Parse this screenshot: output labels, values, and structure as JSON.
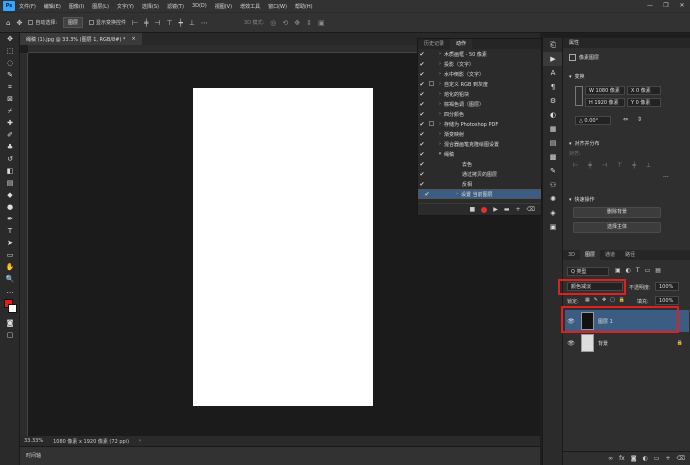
{
  "app": {
    "logo": "Ps"
  },
  "menu": [
    "文件(F)",
    "编辑(E)",
    "图像(I)",
    "图层(L)",
    "文字(Y)",
    "选择(S)",
    "滤镜(T)",
    "3D(D)",
    "视图(V)",
    "增效工具",
    "窗口(W)",
    "帮助(H)"
  ],
  "options": {
    "auto_select": "自动选择:",
    "target": "图层",
    "transform": "显示变换控件",
    "mode3d": "3D 模式:"
  },
  "document": {
    "tab": "绳稿 (1).jpg @ 33.3% (图层 1, RGB/8#) *",
    "close": "×"
  },
  "status": {
    "zoom": "33.33%",
    "size": "1080 像素 x 1920 像素 (72 ppi)"
  },
  "timeline": {
    "label": "时间轴"
  },
  "actions_panel": {
    "tabs": [
      "历史记录",
      "动作"
    ],
    "rows": [
      {
        "label": "木质画框 - 50 像素",
        "check": true,
        "box": false,
        "expand": true
      },
      {
        "label": "投影（文字）",
        "check": true,
        "box": false,
        "expand": true
      },
      {
        "label": "水中倒影（文字）",
        "check": true,
        "box": false,
        "expand": true
      },
      {
        "label": "自定义 RGB 到灰度",
        "check": true,
        "box": true,
        "expand": true
      },
      {
        "label": "熔化的铅块",
        "check": true,
        "box": false,
        "expand": true
      },
      {
        "label": "棕褐色调（图层）",
        "check": true,
        "box": false,
        "expand": true
      },
      {
        "label": "四分颜色",
        "check": true,
        "box": false,
        "expand": true
      },
      {
        "label": "存储为 Photoshop PDF",
        "check": true,
        "box": true,
        "expand": true
      },
      {
        "label": "渐变映射",
        "check": true,
        "box": false,
        "expand": true
      },
      {
        "label": "混合器画笔克隆绘图设置",
        "check": true,
        "box": false,
        "expand": true
      },
      {
        "label": "绳稿",
        "check": true,
        "box": false,
        "expand": "open"
      },
      {
        "label": "去色",
        "check": true,
        "box": false,
        "expand": false
      },
      {
        "label": "通过拷贝的图层",
        "check": true,
        "box": false,
        "expand": false
      },
      {
        "label": "反相",
        "check": true,
        "box": false,
        "expand": false
      },
      {
        "label": "设置 当前图层",
        "check": true,
        "box": false,
        "expand": true,
        "selected": true
      }
    ],
    "foot": [
      "■",
      "●",
      "▶",
      "▬",
      "+",
      "🗑"
    ]
  },
  "properties": {
    "tab": "属性",
    "kind": "像素图层",
    "transform_title": "变换",
    "w": "W  1080 像素",
    "x": "X  0 像素",
    "h": "H  1920 像素",
    "y": "Y  0 像素",
    "angle": "△  0.00°",
    "align_title": "对齐并分布",
    "align_label": "对齐:",
    "quick_title": "快速操作",
    "remove_bg": "删除背景",
    "select_subject": "选择主体"
  },
  "layers": {
    "tabs": [
      "3D",
      "图层",
      "通道",
      "路径"
    ],
    "filter": "Q 类型",
    "blend": "颜色减淡",
    "opacity_label": "不透明度:",
    "opacity": "100%",
    "lock_label": "锁定:",
    "fill_label": "填充:",
    "fill": "100%",
    "items": [
      {
        "name": "图层 1",
        "selected": true
      },
      {
        "name": "背景",
        "selected": false,
        "locked": true
      }
    ]
  }
}
